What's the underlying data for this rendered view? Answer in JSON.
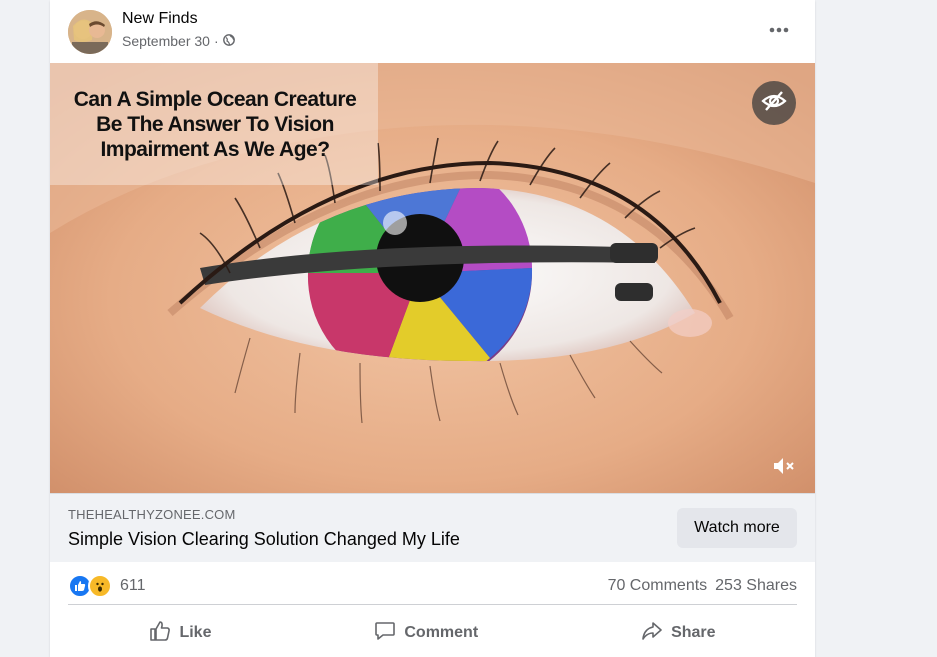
{
  "post": {
    "author": "New Finds",
    "date": "September 30",
    "date_separator": "·",
    "headline": "Can A Simple Ocean Creature Be The Answer To Vision Impairment As We Age?",
    "link": {
      "domain": "THEHEALTHYZONEE.COM",
      "title": "Simple Vision Clearing Solution Changed My Life",
      "cta_label": "Watch more"
    },
    "reactions": {
      "count": "611",
      "types": [
        "like",
        "wow"
      ],
      "comments": "70 Comments",
      "shares": "253 Shares"
    },
    "actions": {
      "like": "Like",
      "comment": "Comment",
      "share": "Share"
    }
  },
  "icons": {
    "privacy": "globe-icon",
    "more": "more-dots-icon",
    "hide": "eye-slash-icon",
    "mute": "muted-speaker-icon"
  },
  "colors": {
    "like_blue": "#1877f2",
    "wow_yellow": "#f7b928",
    "page_bg": "#f0f2f5",
    "secondary_text": "#65676b"
  }
}
